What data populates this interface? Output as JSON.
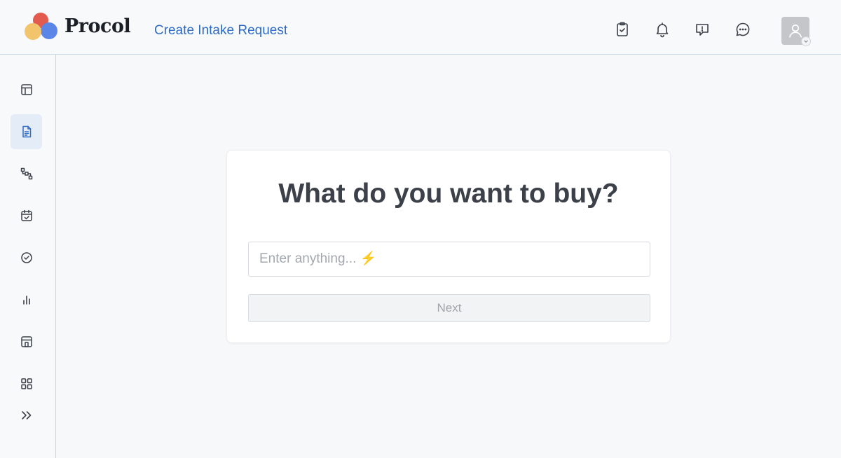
{
  "header": {
    "logo_text": "Procol",
    "page_title": "Create Intake Request",
    "icons": [
      "clipboard-check-icon",
      "bell-icon",
      "feedback-icon",
      "chat-icon",
      "user-avatar"
    ]
  },
  "sidebar": {
    "items": [
      {
        "icon": "layout-icon",
        "active": false
      },
      {
        "icon": "document-icon",
        "active": true
      },
      {
        "icon": "workflow-icon",
        "active": false
      },
      {
        "icon": "calendar-check-icon",
        "active": false
      },
      {
        "icon": "check-circle-icon",
        "active": false
      },
      {
        "icon": "bar-chart-icon",
        "active": false
      },
      {
        "icon": "store-icon",
        "active": false
      },
      {
        "icon": "grid-icon",
        "active": false
      },
      {
        "icon": "chevrons-right-icon",
        "active": false
      }
    ]
  },
  "main": {
    "question": "What do you want to buy?",
    "input_placeholder": "Enter anything... ⚡",
    "input_value": "",
    "next_label": "Next"
  },
  "colors": {
    "accent": "#2f6cc4",
    "active_bg": "#e4ecf8",
    "border": "#c9d6e6"
  }
}
